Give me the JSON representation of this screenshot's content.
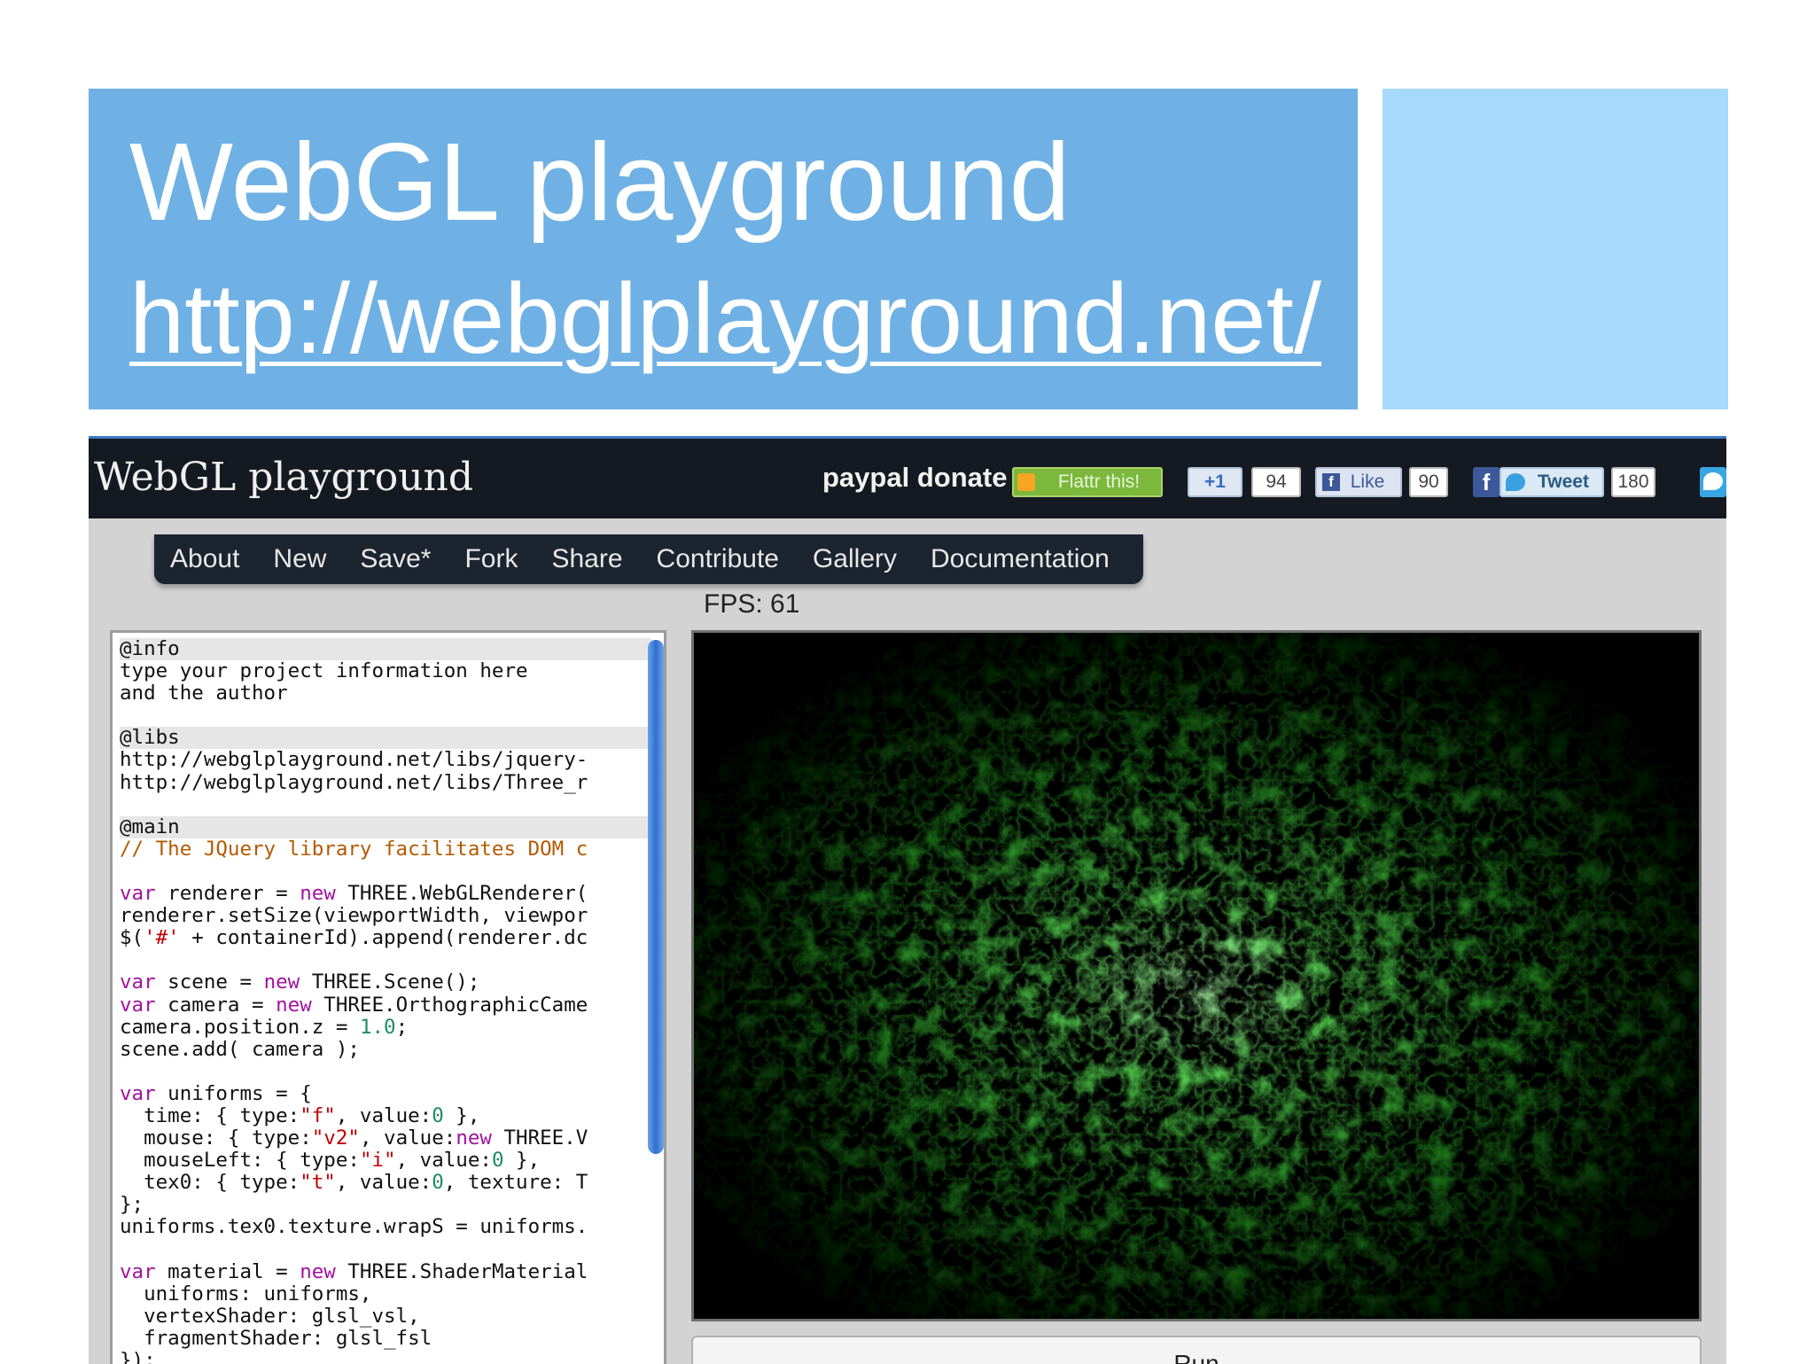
{
  "slide": {
    "title": "WebGL playground",
    "link": "http://webglplayground.net/"
  },
  "header": {
    "logo": "WebGL playground",
    "paypal": "paypal donate",
    "flattr": "Flattr this!",
    "plusone": "+1",
    "plusone_count": "94",
    "like": "Like",
    "like_count": "90",
    "fb_icon": "f",
    "tweet": "Tweet",
    "tweet_count": "180"
  },
  "nav": {
    "items": [
      "About",
      "New",
      "Save*",
      "Fork",
      "Share",
      "Contribute",
      "Gallery",
      "Documentation"
    ]
  },
  "fps": "FPS: 61",
  "run_label": "Run",
  "colors": {
    "title_bg": "#6fb1e4",
    "side_bg": "#a6d9fb",
    "topbar_bg": "#151a22",
    "scene_green": "#3fd23a"
  },
  "icons": {
    "flattr": "flattr-icon",
    "facebook": "facebook-icon",
    "twitter": "twitter-bird-icon"
  },
  "editor": {
    "lines": [
      "@info",
      "type your project information here",
      "and the author",
      "",
      "@libs",
      "http://webglplayground.net/libs/jquery-",
      "http://webglplayground.net/libs/Three_r",
      "",
      "@main",
      "// The JQuery library facilitates DOM c",
      "",
      "var renderer = new THREE.WebGLRenderer(",
      "renderer.setSize(viewportWidth, viewpor",
      "$('#' + containerId).append(renderer.dc",
      "",
      "var scene = new THREE.Scene();",
      "var camera = new THREE.OrthographicCame",
      "camera.position.z = 1.0;",
      "scene.add( camera );",
      "",
      "var uniforms = {",
      "  time: { type:\"f\", value:0 },",
      "  mouse: { type:\"v2\", value:new THREE.V",
      "  mouseLeft: { type:\"i\", value:0 },",
      "  tex0: { type:\"t\", value:0, texture: T",
      "};",
      "uniforms.tex0.texture.wrapS = uniforms.",
      "",
      "var material = new THREE.ShaderMaterial",
      "  uniforms: uniforms,",
      "  vertexShader: glsl_vsl,",
      "  fragmentShader: glsl_fsl",
      "});"
    ]
  }
}
